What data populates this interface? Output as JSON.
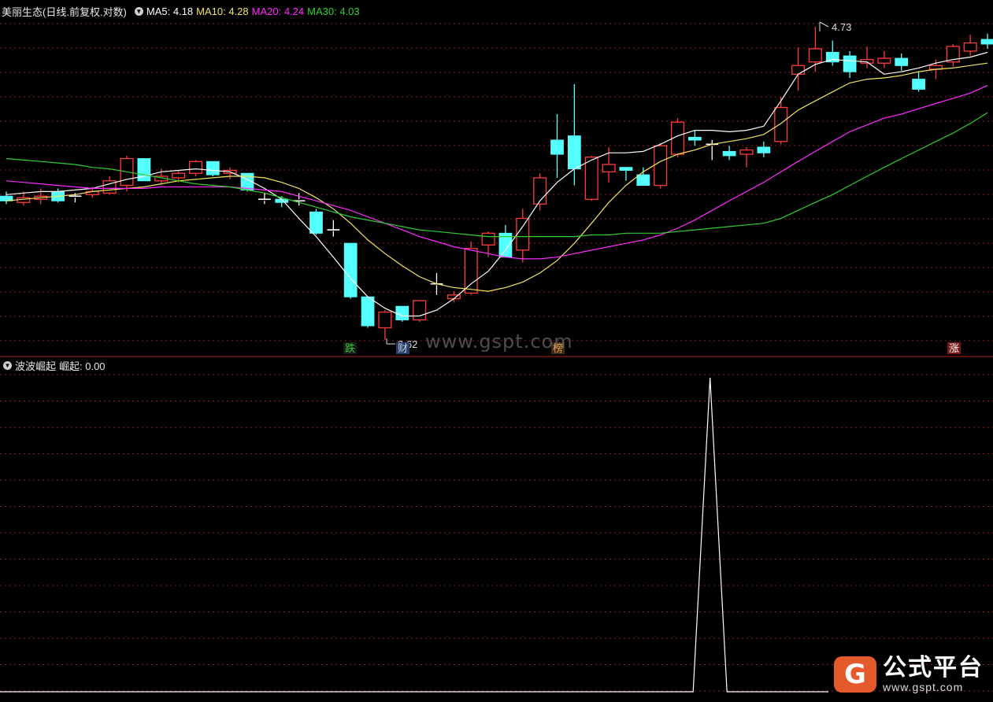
{
  "header_main": {
    "title": "美丽生态(日线.前复权.对数)",
    "ma5_label": "MA5: 4.18",
    "ma10_label": "MA10: 4.28",
    "ma20_label": "MA20: 4.24",
    "ma30_label": "MA30: 4.03"
  },
  "header_indicator": {
    "title": "波波崛起",
    "value_label": "崛起: 0.00"
  },
  "annotations": {
    "high_label": "4.73",
    "low_label": "2.62",
    "tag_die": "跌",
    "tag_cai": "财",
    "tag_bang": "榜",
    "tag_zhang": "涨"
  },
  "watermark": "www.gspt.com",
  "logo": {
    "icon": "G",
    "name": "公式平台",
    "url": "www.gspt.com"
  },
  "colors": {
    "up": "#ff3b3b",
    "down": "#54ffff",
    "ma5": "#ffffff",
    "ma10": "#f2e45c",
    "ma20": "#ff2aff",
    "ma30": "#2ecf2e",
    "grid": "#8a1c1c",
    "divider": "#b02020",
    "indicator": "#ffffff"
  },
  "chart_data": [
    {
      "type": "candlestick",
      "series": [
        {
          "name": "MA5",
          "values": [
            3.46,
            3.47,
            3.48,
            3.48,
            3.49,
            3.5,
            3.53,
            3.56,
            3.58,
            3.61,
            3.62,
            3.63,
            3.62,
            3.61,
            3.56,
            3.5,
            3.43,
            3.31,
            3.2,
            3.08,
            2.96,
            2.86,
            2.8,
            2.76,
            2.76,
            2.79,
            2.85,
            2.93,
            3.0,
            3.12,
            3.26,
            3.42,
            3.54,
            3.63,
            3.69,
            3.74,
            3.74,
            3.75,
            3.8,
            3.86,
            3.9,
            3.9,
            3.89,
            3.9,
            3.93,
            4.12,
            4.33,
            4.41,
            4.45,
            4.44,
            4.43,
            4.33,
            4.35,
            4.38,
            4.42,
            4.45,
            4.47,
            4.51
          ]
        },
        {
          "name": "MA10",
          "values": [
            3.42,
            3.43,
            3.44,
            3.45,
            3.46,
            3.48,
            3.49,
            3.5,
            3.51,
            3.53,
            3.55,
            3.56,
            3.57,
            3.58,
            3.58,
            3.57,
            3.54,
            3.5,
            3.44,
            3.37,
            3.28,
            3.18,
            3.1,
            3.03,
            2.97,
            2.93,
            2.91,
            2.9,
            2.89,
            2.91,
            2.94,
            2.99,
            3.06,
            3.16,
            3.28,
            3.41,
            3.52,
            3.61,
            3.68,
            3.73,
            3.76,
            3.8,
            3.82,
            3.84,
            3.87,
            3.95,
            4.05,
            4.12,
            4.19,
            4.26,
            4.29,
            4.3,
            4.32,
            4.35,
            4.37,
            4.38,
            4.4,
            4.42
          ]
        },
        {
          "name": "MA20",
          "values": [
            3.55,
            3.54,
            3.53,
            3.52,
            3.51,
            3.5,
            3.5,
            3.5,
            3.5,
            3.51,
            3.51,
            3.51,
            3.51,
            3.51,
            3.5,
            3.49,
            3.48,
            3.45,
            3.42,
            3.39,
            3.36,
            3.32,
            3.28,
            3.24,
            3.2,
            3.17,
            3.14,
            3.12,
            3.1,
            3.08,
            3.07,
            3.07,
            3.08,
            3.1,
            3.12,
            3.14,
            3.16,
            3.18,
            3.21,
            3.25,
            3.3,
            3.36,
            3.42,
            3.48,
            3.54,
            3.61,
            3.68,
            3.75,
            3.82,
            3.89,
            3.94,
            3.99,
            4.02,
            4.06,
            4.1,
            4.14,
            4.18,
            4.24
          ]
        },
        {
          "name": "MA30",
          "values": [
            3.7,
            3.69,
            3.68,
            3.67,
            3.66,
            3.64,
            3.63,
            3.61,
            3.59,
            3.57,
            3.55,
            3.53,
            3.52,
            3.51,
            3.49,
            3.47,
            3.44,
            3.41,
            3.38,
            3.35,
            3.32,
            3.3,
            3.28,
            3.26,
            3.24,
            3.23,
            3.22,
            3.21,
            3.2,
            3.2,
            3.2,
            3.2,
            3.2,
            3.2,
            3.21,
            3.21,
            3.22,
            3.22,
            3.22,
            3.23,
            3.24,
            3.25,
            3.26,
            3.27,
            3.28,
            3.31,
            3.36,
            3.41,
            3.46,
            3.52,
            3.58,
            3.64,
            3.7,
            3.76,
            3.82,
            3.88,
            3.95,
            4.03
          ]
        }
      ],
      "ohlc": [
        [
          3.45,
          3.48,
          3.4,
          3.42
        ],
        [
          3.41,
          3.48,
          3.39,
          3.44
        ],
        [
          3.43,
          3.5,
          3.4,
          3.45
        ],
        [
          3.48,
          3.5,
          3.41,
          3.42
        ],
        [
          3.44,
          3.47,
          3.41,
          3.45
        ],
        [
          3.46,
          3.51,
          3.44,
          3.48
        ],
        [
          3.47,
          3.58,
          3.46,
          3.55
        ],
        [
          3.52,
          3.72,
          3.48,
          3.7
        ],
        [
          3.7,
          3.7,
          3.55,
          3.55
        ],
        [
          3.55,
          3.63,
          3.53,
          3.58
        ],
        [
          3.57,
          3.62,
          3.54,
          3.6
        ],
        [
          3.6,
          3.69,
          3.58,
          3.68
        ],
        [
          3.68,
          3.68,
          3.58,
          3.59
        ],
        [
          3.6,
          3.64,
          3.56,
          3.62
        ],
        [
          3.6,
          3.6,
          3.48,
          3.49
        ],
        [
          3.42,
          3.47,
          3.4,
          3.43
        ],
        [
          3.43,
          3.45,
          3.38,
          3.41
        ],
        [
          3.43,
          3.47,
          3.39,
          3.42
        ],
        [
          3.35,
          3.37,
          3.21,
          3.22
        ],
        [
          3.24,
          3.3,
          3.2,
          3.24
        ],
        [
          3.16,
          3.16,
          2.85,
          2.86
        ],
        [
          2.86,
          2.86,
          2.7,
          2.71
        ],
        [
          2.7,
          2.79,
          2.64,
          2.78
        ],
        [
          2.81,
          2.81,
          2.73,
          2.74
        ],
        [
          2.74,
          2.84,
          2.73,
          2.84
        ],
        [
          2.93,
          2.99,
          2.87,
          2.93
        ],
        [
          2.85,
          2.89,
          2.83,
          2.87
        ],
        [
          2.88,
          3.17,
          2.87,
          3.13
        ],
        [
          3.15,
          3.23,
          3.08,
          3.22
        ],
        [
          3.22,
          3.27,
          3.08,
          3.08
        ],
        [
          3.12,
          3.37,
          3.05,
          3.31
        ],
        [
          3.4,
          3.6,
          3.36,
          3.57
        ],
        [
          3.83,
          4.02,
          3.57,
          3.73
        ],
        [
          3.86,
          4.25,
          3.52,
          3.63
        ],
        [
          3.43,
          3.72,
          3.42,
          3.71
        ],
        [
          3.61,
          3.78,
          3.54,
          3.66
        ],
        [
          3.64,
          3.64,
          3.55,
          3.62
        ],
        [
          3.59,
          3.64,
          3.56,
          3.52
        ],
        [
          3.52,
          3.81,
          3.5,
          3.79
        ],
        [
          3.73,
          3.99,
          3.71,
          3.96
        ],
        [
          3.85,
          3.9,
          3.79,
          3.83
        ],
        [
          3.79,
          3.83,
          3.69,
          3.8
        ],
        [
          3.75,
          3.79,
          3.69,
          3.72
        ],
        [
          3.73,
          3.78,
          3.64,
          3.76
        ],
        [
          3.78,
          3.82,
          3.71,
          3.74
        ],
        [
          3.82,
          4.15,
          3.8,
          4.07
        ],
        [
          4.33,
          4.55,
          4.2,
          4.4
        ],
        [
          4.43,
          4.73,
          4.35,
          4.54
        ],
        [
          4.51,
          4.61,
          4.4,
          4.43
        ],
        [
          4.48,
          4.52,
          4.3,
          4.35
        ],
        [
          4.42,
          4.56,
          4.38,
          4.45
        ],
        [
          4.42,
          4.52,
          4.38,
          4.46
        ],
        [
          4.46,
          4.5,
          4.36,
          4.4
        ],
        [
          4.29,
          4.35,
          4.19,
          4.21
        ],
        [
          4.37,
          4.45,
          4.29,
          4.4
        ],
        [
          4.43,
          4.58,
          4.39,
          4.56
        ],
        [
          4.52,
          4.66,
          4.48,
          4.59
        ],
        [
          4.62,
          4.67,
          4.54,
          4.58
        ]
      ]
    },
    {
      "type": "line",
      "series": [
        {
          "name": "崛起",
          "values": [
            0,
            0,
            0,
            0,
            0,
            0,
            0,
            0,
            0,
            0,
            0,
            0,
            0,
            0,
            0,
            0,
            0,
            0,
            0,
            0,
            0,
            0,
            0,
            0,
            0,
            0,
            0,
            0,
            0,
            0,
            0,
            0,
            0,
            0,
            0,
            0,
            0,
            0,
            0,
            0,
            0,
            0,
            1,
            0,
            0,
            0,
            0,
            0,
            0,
            0
          ]
        }
      ]
    }
  ]
}
